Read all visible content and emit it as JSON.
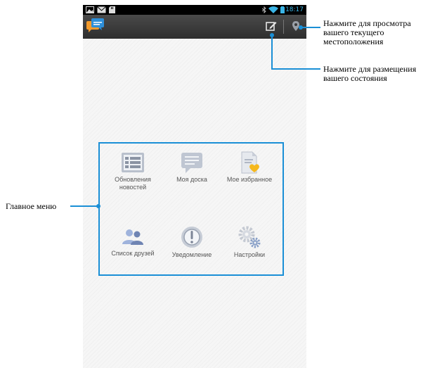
{
  "status_bar": {
    "time": "18:17"
  },
  "callouts": {
    "location": [
      "Нажмите для просмотра",
      "вашего текущего",
      "местоположения"
    ],
    "status": [
      "Нажмите для размещения",
      "вашего состояния"
    ],
    "main_menu": "Главное меню"
  },
  "menu": {
    "items": [
      {
        "label_lines": [
          "Обновления",
          "новостей"
        ],
        "icon": "news-feed-icon"
      },
      {
        "label_lines": [
          "Моя доска"
        ],
        "icon": "message-board-icon"
      },
      {
        "label_lines": [
          "Мое избранное"
        ],
        "icon": "favorites-icon"
      },
      {
        "label_lines": [
          "Список друзей"
        ],
        "icon": "friends-icon"
      },
      {
        "label_lines": [
          "Уведомление"
        ],
        "icon": "notification-icon"
      },
      {
        "label_lines": [
          "Настройки"
        ],
        "icon": "settings-icon"
      }
    ]
  },
  "colors": {
    "accent": "#1a8fd6",
    "icon_blue": "#8fa6d4",
    "icon_grey": "#b5bccb",
    "heart": "#f5b81e",
    "time": "#3ab4e6"
  }
}
